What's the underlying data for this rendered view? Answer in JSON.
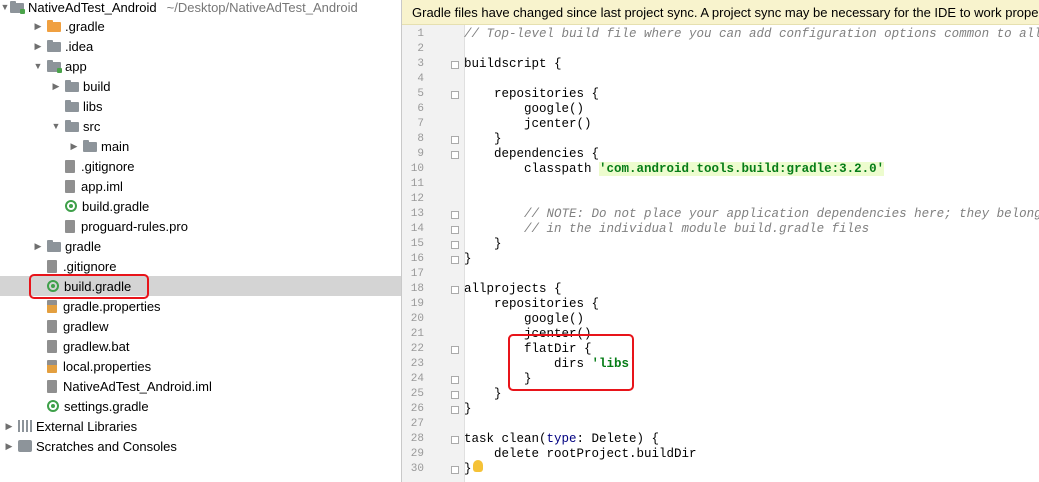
{
  "project_tree": {
    "root": {
      "name": "NativeAdTest_Android",
      "path": "~/Desktop/NativeAdTest_Android"
    },
    "items": [
      {
        "label": ".gradle",
        "icon": "folder-orange-icon",
        "arrow": "▶"
      },
      {
        "label": ".idea",
        "icon": "folder-icon",
        "arrow": "▶"
      },
      {
        "label": "app",
        "icon": "module-folder-icon",
        "arrow": "▼"
      },
      {
        "label": "build",
        "icon": "folder-icon",
        "arrow": "▶"
      },
      {
        "label": "libs",
        "icon": "folder-icon",
        "arrow": ""
      },
      {
        "label": "src",
        "icon": "folder-icon",
        "arrow": "▼"
      },
      {
        "label": "main",
        "icon": "folder-icon",
        "arrow": "▶"
      },
      {
        "label": ".gitignore",
        "icon": "file-icon",
        "arrow": ""
      },
      {
        "label": "app.iml",
        "icon": "file-icon",
        "arrow": ""
      },
      {
        "label": "build.gradle",
        "icon": "gradle-icon",
        "arrow": ""
      },
      {
        "label": "proguard-rules.pro",
        "icon": "file-icon",
        "arrow": ""
      },
      {
        "label": "gradle",
        "icon": "folder-icon",
        "arrow": "▶"
      },
      {
        "label": ".gitignore",
        "icon": "file-icon",
        "arrow": ""
      },
      {
        "label": "build.gradle",
        "icon": "gradle-icon",
        "arrow": ""
      },
      {
        "label": "gradle.properties",
        "icon": "properties-file-icon",
        "arrow": ""
      },
      {
        "label": "gradlew",
        "icon": "file-icon",
        "arrow": ""
      },
      {
        "label": "gradlew.bat",
        "icon": "file-icon",
        "arrow": ""
      },
      {
        "label": "local.properties",
        "icon": "properties-file-icon",
        "arrow": ""
      },
      {
        "label": "NativeAdTest_Android.iml",
        "icon": "file-icon",
        "arrow": ""
      },
      {
        "label": "settings.gradle",
        "icon": "gradle-icon",
        "arrow": ""
      },
      {
        "label": "External Libraries",
        "icon": "libraries-icon",
        "arrow": "▶"
      },
      {
        "label": "Scratches and Consoles",
        "icon": "scratches-icon",
        "arrow": "▶"
      }
    ],
    "selected_index": 13
  },
  "editor": {
    "banner": "Gradle files have changed since last project sync. A project sync may be necessary for the IDE to work properly.",
    "lines": [
      {
        "n": "1",
        "text": "// Top-level build file where you can add configuration options common to all sub-projects/modules."
      },
      {
        "n": "2",
        "text": ""
      },
      {
        "n": "3",
        "text": "buildscript {"
      },
      {
        "n": "4",
        "text": ""
      },
      {
        "n": "5",
        "text": "    repositories {"
      },
      {
        "n": "6",
        "text": "        google()"
      },
      {
        "n": "7",
        "text": "        jcenter()"
      },
      {
        "n": "8",
        "text": "    }"
      },
      {
        "n": "9",
        "text": "    dependencies {"
      },
      {
        "n": "10",
        "text": "        classpath 'com.android.tools.build:gradle:3.2.0'"
      },
      {
        "n": "11",
        "text": ""
      },
      {
        "n": "12",
        "text": ""
      },
      {
        "n": "13",
        "text": "        // NOTE: Do not place your application dependencies here; they belong"
      },
      {
        "n": "14",
        "text": "        // in the individual module build.gradle files"
      },
      {
        "n": "15",
        "text": "    }"
      },
      {
        "n": "16",
        "text": "}"
      },
      {
        "n": "17",
        "text": ""
      },
      {
        "n": "18",
        "text": "allprojects {"
      },
      {
        "n": "19",
        "text": "    repositories {"
      },
      {
        "n": "20",
        "text": "        google()"
      },
      {
        "n": "21",
        "text": "        jcenter()"
      },
      {
        "n": "22",
        "text": "        flatDir {"
      },
      {
        "n": "23",
        "text": "            dirs 'libs'"
      },
      {
        "n": "24",
        "text": "        }"
      },
      {
        "n": "25",
        "text": "    }"
      },
      {
        "n": "26",
        "text": "}"
      },
      {
        "n": "27",
        "text": ""
      },
      {
        "n": "28",
        "text": "task clean(type: Delete) {"
      },
      {
        "n": "29",
        "text": "    delete rootProject.buildDir"
      },
      {
        "n": "30",
        "text": "}"
      }
    ]
  },
  "colors": {
    "highlight": "#e8141a",
    "banner": "#f8f3cd",
    "selection": "#d4d4d4"
  }
}
